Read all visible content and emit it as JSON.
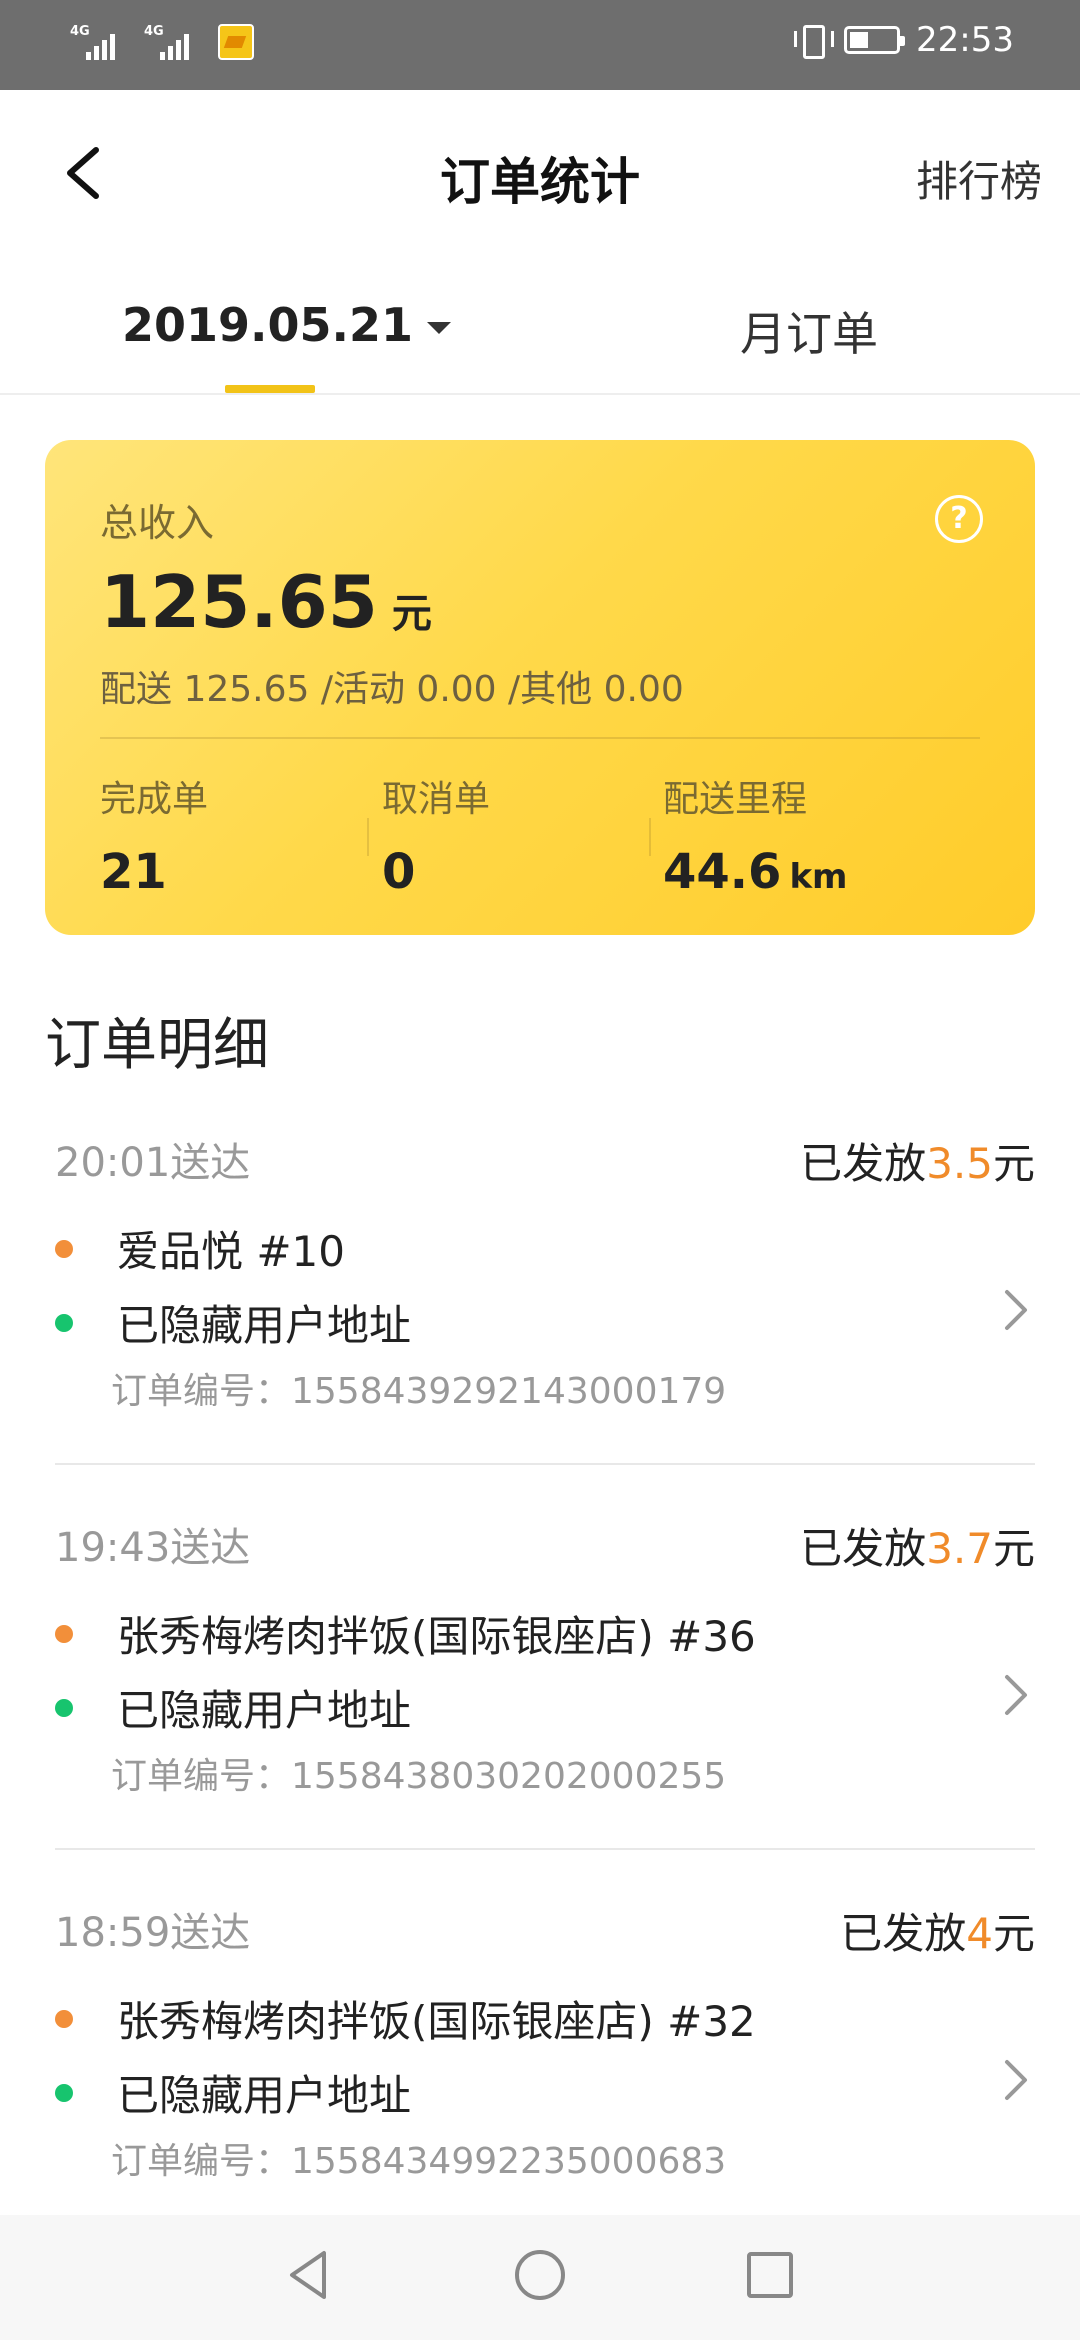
{
  "status_bar": {
    "network_1": "4G",
    "network_2": "4G",
    "time": "22:53",
    "icons": [
      "signal-icon",
      "signal-icon",
      "app-notification-icon",
      "vibrate-icon",
      "battery-icon"
    ]
  },
  "header": {
    "title": "订单统计",
    "right_link": "排行榜",
    "back_icon": "back-arrow-icon"
  },
  "tabs": {
    "date_label": "2019.05.21",
    "month_label": "月订单",
    "active_accent": "#f2c318"
  },
  "income_card": {
    "label": "总收入",
    "amount": "125.65",
    "unit": "元",
    "breakdown": "配送 125.65  /活动 0.00  /其他 0.00",
    "stats": [
      {
        "label": "完成单",
        "value": "21",
        "unit": ""
      },
      {
        "label": "取消单",
        "value": "0",
        "unit": ""
      },
      {
        "label": "配送里程",
        "value": "44.6",
        "unit": "km"
      }
    ],
    "colors": {
      "gradient_start": "#ffe57a",
      "gradient_end": "#ffcc2a"
    }
  },
  "detail": {
    "title": "订单明细",
    "orders": [
      {
        "time": "20:01送达",
        "paid_prefix": "已发放",
        "paid_amount": "3.5",
        "paid_suffix": "元",
        "shop": "爱品悦 #10",
        "address": "已隐藏用户地址",
        "order_no": "订单编号：1558439292143000179"
      },
      {
        "time": "19:43送达",
        "paid_prefix": "已发放",
        "paid_amount": "3.7",
        "paid_suffix": "元",
        "shop": "张秀梅烤肉拌饭(国际银座店) #36",
        "address": "已隐藏用户地址",
        "order_no": "订单编号：1558438030202000255"
      },
      {
        "time": "18:59送达",
        "paid_prefix": "已发放",
        "paid_amount": "4",
        "paid_suffix": "元",
        "shop": "张秀梅烤肉拌饭(国际银座店) #32",
        "address": "已隐藏用户地址",
        "order_no": "订单编号：1558434992235000683"
      }
    ],
    "colors": {
      "amount": "#f08b2a",
      "shop_dot": "#f28f3a",
      "address_dot": "#17c46e"
    }
  },
  "system_nav": {
    "icons": [
      "back-triangle-icon",
      "home-circle-icon",
      "recents-square-icon"
    ]
  }
}
